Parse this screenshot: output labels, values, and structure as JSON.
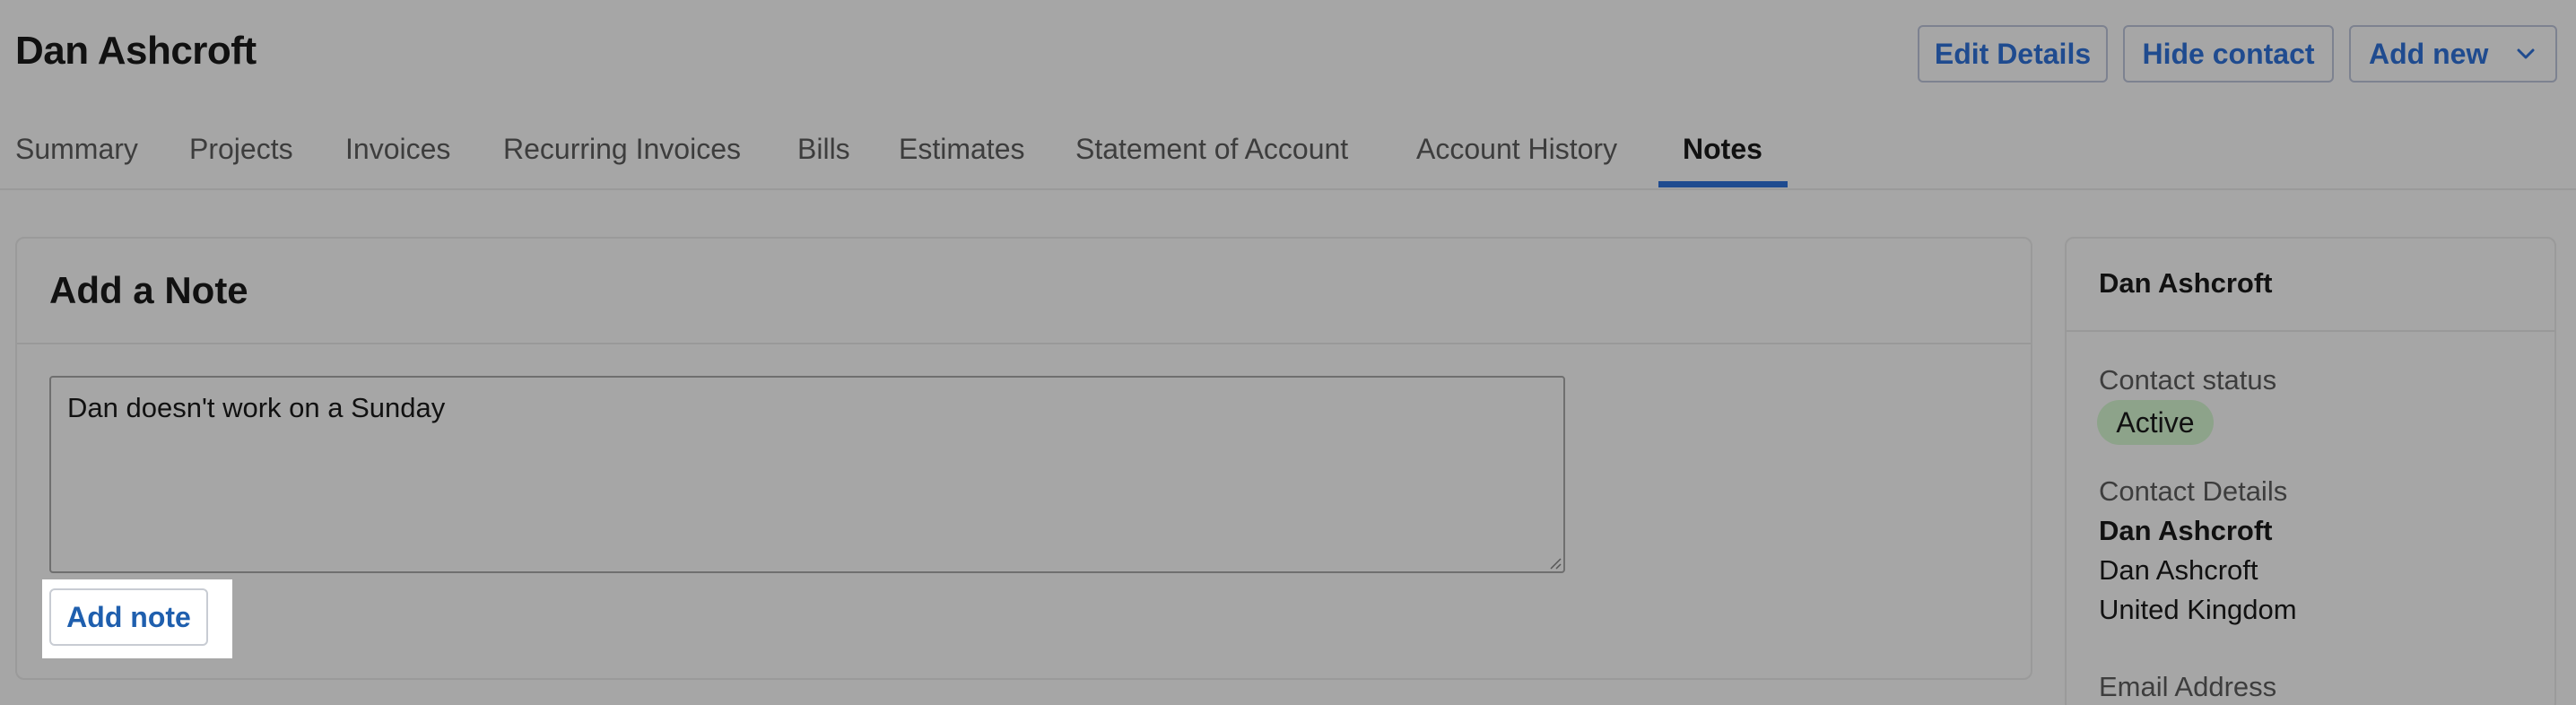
{
  "header": {
    "title": "Dan Ashcroft",
    "buttons": {
      "edit": "Edit Details",
      "hide": "Hide contact",
      "add_new": "Add new"
    }
  },
  "tabs": [
    {
      "label": "Summary"
    },
    {
      "label": "Projects"
    },
    {
      "label": "Invoices"
    },
    {
      "label": "Recurring Invoices"
    },
    {
      "label": "Bills"
    },
    {
      "label": "Estimates"
    },
    {
      "label": "Statement of Account"
    },
    {
      "label": "Account History"
    },
    {
      "label": "Notes",
      "active": true
    }
  ],
  "note_form": {
    "title": "Add a Note",
    "text": "Dan doesn't work on a Sunday",
    "submit_label": "Add note"
  },
  "side_panel": {
    "name": "Dan Ashcroft",
    "status_label": "Contact status",
    "status": "Active",
    "details_label": "Contact Details",
    "details": [
      "Dan Ashcroft",
      "Dan Ashcroft",
      "United Kingdom"
    ],
    "email_label": "Email Address"
  },
  "colors": {
    "accent": "#1f4b8f",
    "link": "#1f5fae",
    "status_active_bg": "#8da38a"
  },
  "icons": {
    "add_new_caret": "chevron-down-icon",
    "textarea_grip": "resize-grip-icon"
  }
}
